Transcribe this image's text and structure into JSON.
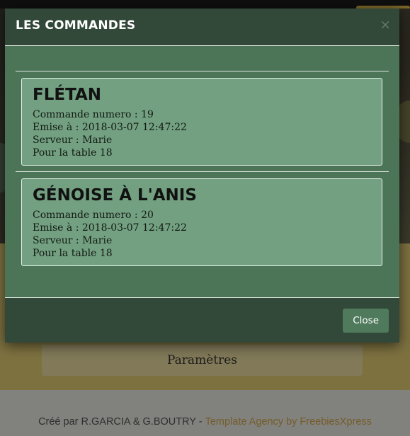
{
  "background": {
    "params_label": "Paramètres",
    "footer_text": "Créé par R.GARCIA & G.BOUTRY -",
    "footer_link": "Template Agency by FreebiesXpress"
  },
  "modal": {
    "title": "LES COMMANDES",
    "close_icon": "×",
    "orders": [
      {
        "name": "FLÉTAN",
        "line1": "Commande numero : 19",
        "line2": "Emise à : 2018-03-07 12:47:22",
        "line3": "Serveur : Marie",
        "line4": "Pour la table 18"
      },
      {
        "name": "GÉNOISE À L'ANIS",
        "line1": "Commande numero : 20",
        "line2": "Emise à : 2018-03-07 12:47:22",
        "line3": "Serveur : Marie",
        "line4": "Pour la table 18"
      }
    ],
    "close_label": "Close"
  },
  "colors": {
    "modal_header": "#324838",
    "modal_body": "#4c7558",
    "card": "#72a081",
    "accent_yellow": "#e3ce76",
    "footer_link": "#d6a94a"
  }
}
